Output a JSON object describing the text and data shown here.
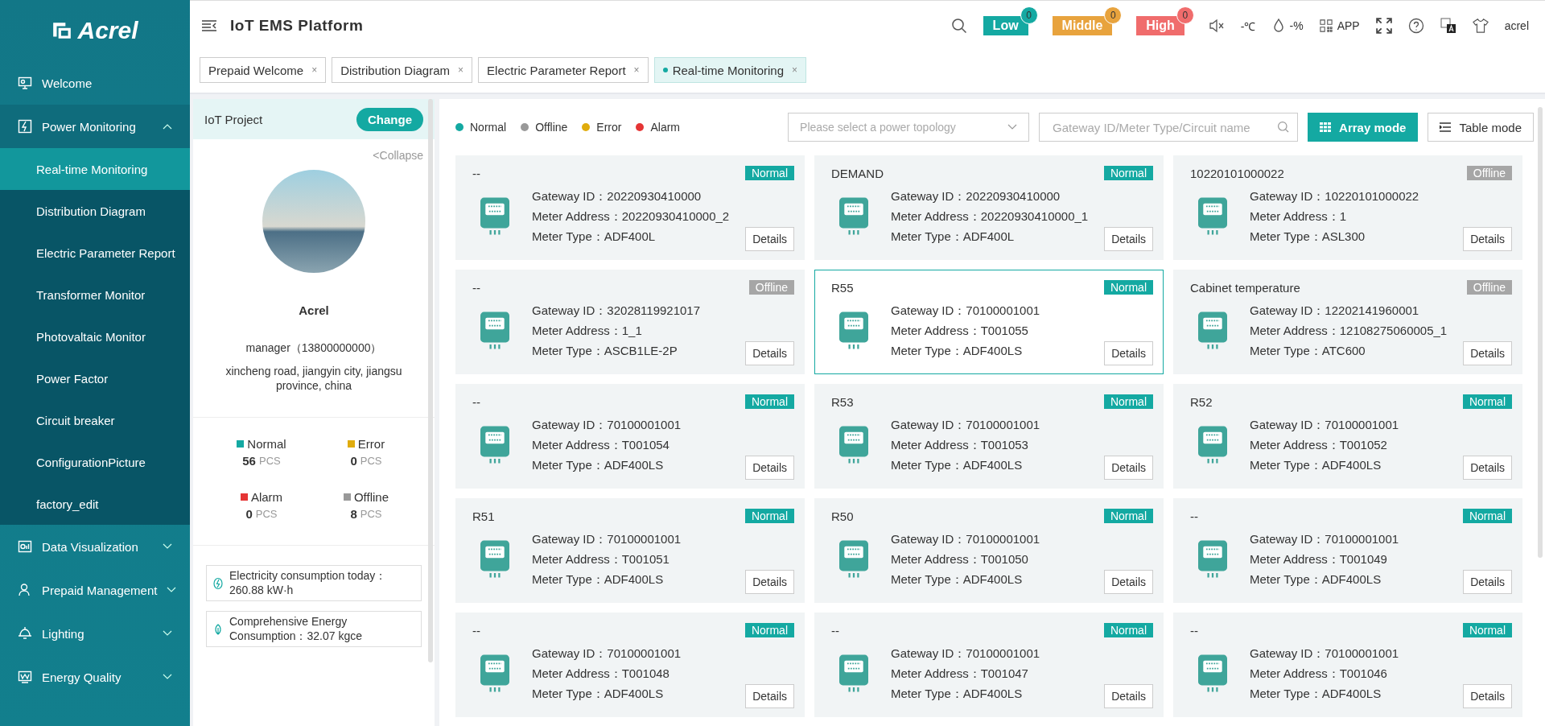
{
  "sidebar": {
    "logo": "Acrel",
    "items": [
      {
        "label": "Welcome"
      },
      {
        "label": "Power Monitoring",
        "expanded": true,
        "children": [
          {
            "label": "Real-time Monitoring",
            "selected": true
          },
          {
            "label": "Distribution Diagram",
            "selected": false
          },
          {
            "label": "Electric Parameter Report",
            "selected": false
          },
          {
            "label": "Transformer Monitor",
            "selected": false
          },
          {
            "label": "Photovaltaic Monitor",
            "selected": false
          },
          {
            "label": "Power Factor",
            "selected": false
          },
          {
            "label": "Circuit breaker",
            "selected": false
          },
          {
            "label": "ConfigurationPicture",
            "selected": false
          },
          {
            "label": "factory_edit",
            "selected": false
          }
        ]
      },
      {
        "label": "Data Visualization",
        "expanded": false
      },
      {
        "label": "Prepaid Management",
        "expanded": false
      },
      {
        "label": "Lighting",
        "expanded": false
      },
      {
        "label": "Energy Quality",
        "expanded": false
      }
    ]
  },
  "header": {
    "title": "IoT EMS Platform",
    "alerts": [
      {
        "label": "Low",
        "count": "0",
        "color": "#14a9a2"
      },
      {
        "label": "Middle",
        "count": "0",
        "color": "#e8a33d"
      },
      {
        "label": "High",
        "count": "0",
        "color": "#f06c6c"
      }
    ],
    "temperature": "-℃",
    "humidity": "-%",
    "app": "APP",
    "user": "acrel"
  },
  "tabs": [
    {
      "label": "Prepaid Welcome",
      "close": "×",
      "selected": false
    },
    {
      "label": "Distribution Diagram",
      "close": "×",
      "selected": false
    },
    {
      "label": "Electric Parameter Report",
      "close": "×",
      "selected": false
    },
    {
      "label": "Real-time Monitoring",
      "close": "×",
      "selected": true
    }
  ],
  "project": {
    "title": "IoT Project",
    "change": "Change",
    "collapse": "<Collapse",
    "name": "Acrel",
    "manager": "manager（13800000000）",
    "address": "xincheng road, jiangyin city, jiangsu province, china",
    "stats": [
      {
        "label": "Normal",
        "count": "56",
        "unit": "PCS",
        "color": "#14a9a2"
      },
      {
        "label": "Error",
        "count": "0",
        "unit": "PCS",
        "color": "#e0ac0d"
      },
      {
        "label": "Alarm",
        "count": "0",
        "unit": "PCS",
        "color": "#e53535"
      },
      {
        "label": "Offline",
        "count": "8",
        "unit": "PCS",
        "color": "#999999"
      }
    ],
    "info": [
      {
        "kind": "electricity",
        "text": "Electricity consumption today：260.88 kW·h"
      },
      {
        "kind": "energy",
        "text": "Comprehensive Energy Consumption：32.07 kgce"
      }
    ]
  },
  "legend": [
    {
      "label": "Normal",
      "color": "#14a9a2"
    },
    {
      "label": "Offline",
      "color": "#999999"
    },
    {
      "label": "Error",
      "color": "#e0ac0d"
    },
    {
      "label": "Alarm",
      "color": "#e53535"
    }
  ],
  "topology": {
    "placeholder": "Please select a power topology"
  },
  "search": {
    "placeholder": "Gateway ID/Meter Type/Circuit name"
  },
  "modes": [
    {
      "label": "Array mode",
      "kind": "grid",
      "selected": true
    },
    {
      "label": "Table mode",
      "kind": "list",
      "selected": false
    }
  ],
  "cards": [
    {
      "name": "--",
      "status_label": "Normal",
      "color": "#14a9a2",
      "selected": false,
      "gateway": "Gateway ID：20220930410000",
      "address": "Meter Address：20220930410000_2",
      "type": "Meter Type：ADF400L",
      "details": "Details"
    },
    {
      "name": "DEMAND",
      "status_label": "Normal",
      "color": "#14a9a2",
      "selected": false,
      "gateway": "Gateway ID：20220930410000",
      "address": "Meter Address：20220930410000_1",
      "type": "Meter Type：ADF400L",
      "details": "Details"
    },
    {
      "name": "10220101000022",
      "status_label": "Offline",
      "color": "#a6a6a6",
      "selected": false,
      "gateway": "Gateway ID：10220101000022",
      "address": "Meter Address：1",
      "type": "Meter Type：ASL300",
      "details": "Details"
    },
    {
      "name": "--",
      "status_label": "Offline",
      "color": "#a6a6a6",
      "selected": false,
      "gateway": "Gateway ID：32028119921017",
      "address": "Meter Address：1_1",
      "type": "Meter Type：ASCB1LE-2P",
      "details": "Details"
    },
    {
      "name": "R55",
      "status_label": "Normal",
      "color": "#14a9a2",
      "selected": true,
      "gateway": "Gateway ID：70100001001",
      "address": "Meter Address：T001055",
      "type": "Meter Type：ADF400LS",
      "details": "Details"
    },
    {
      "name": "Cabinet temperature",
      "status_label": "Offline",
      "color": "#a6a6a6",
      "selected": false,
      "gateway": "Gateway ID：12202141960001",
      "address": "Meter Address：12108275060005_1",
      "type": "Meter Type：ATC600",
      "details": "Details"
    },
    {
      "name": "--",
      "status_label": "Normal",
      "color": "#14a9a2",
      "selected": false,
      "gateway": "Gateway ID：70100001001",
      "address": "Meter Address：T001054",
      "type": "Meter Type：ADF400LS",
      "details": "Details"
    },
    {
      "name": "R53",
      "status_label": "Normal",
      "color": "#14a9a2",
      "selected": false,
      "gateway": "Gateway ID：70100001001",
      "address": "Meter Address：T001053",
      "type": "Meter Type：ADF400LS",
      "details": "Details"
    },
    {
      "name": "R52",
      "status_label": "Normal",
      "color": "#14a9a2",
      "selected": false,
      "gateway": "Gateway ID：70100001001",
      "address": "Meter Address：T001052",
      "type": "Meter Type：ADF400LS",
      "details": "Details"
    },
    {
      "name": "R51",
      "status_label": "Normal",
      "color": "#14a9a2",
      "selected": false,
      "gateway": "Gateway ID：70100001001",
      "address": "Meter Address：T001051",
      "type": "Meter Type：ADF400LS",
      "details": "Details"
    },
    {
      "name": "R50",
      "status_label": "Normal",
      "color": "#14a9a2",
      "selected": false,
      "gateway": "Gateway ID：70100001001",
      "address": "Meter Address：T001050",
      "type": "Meter Type：ADF400LS",
      "details": "Details"
    },
    {
      "name": "--",
      "status_label": "Normal",
      "color": "#14a9a2",
      "selected": false,
      "gateway": "Gateway ID：70100001001",
      "address": "Meter Address：T001049",
      "type": "Meter Type：ADF400LS",
      "details": "Details"
    },
    {
      "name": "--",
      "status_label": "Normal",
      "color": "#14a9a2",
      "selected": false,
      "gateway": "Gateway ID：70100001001",
      "address": "Meter Address：T001048",
      "type": "Meter Type：ADF400LS",
      "details": "Details"
    },
    {
      "name": "--",
      "status_label": "Normal",
      "color": "#14a9a2",
      "selected": false,
      "gateway": "Gateway ID：70100001001",
      "address": "Meter Address：T001047",
      "type": "Meter Type：ADF400LS",
      "details": "Details"
    },
    {
      "name": "--",
      "status_label": "Normal",
      "color": "#14a9a2",
      "selected": false,
      "gateway": "Gateway ID：70100001001",
      "address": "Meter Address：T001046",
      "type": "Meter Type：ADF400LS",
      "details": "Details"
    }
  ]
}
